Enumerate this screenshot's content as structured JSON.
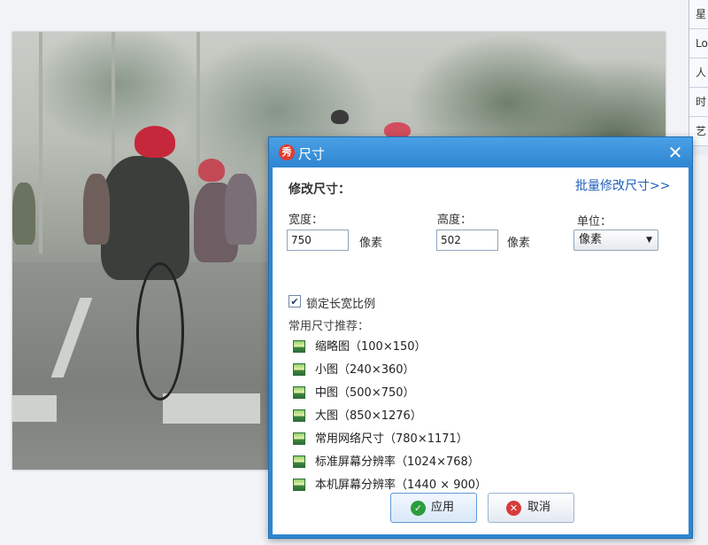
{
  "side_panel": {
    "items": [
      "星",
      "Lo",
      "人",
      "时",
      "艺"
    ]
  },
  "dialog": {
    "title": "尺寸",
    "app_icon_text": "秀",
    "close_icon": "close-icon",
    "heading": "修改尺寸：",
    "batch_link": "批量修改尺寸>>",
    "width": {
      "label": "宽度：",
      "value": "750",
      "unit": "像素"
    },
    "height": {
      "label": "高度：",
      "value": "502",
      "unit": "像素"
    },
    "unit_select": {
      "label": "单位：",
      "selected": "像素"
    },
    "lock_ratio": {
      "label": "锁定长宽比例",
      "checked": true
    },
    "presets_heading": "常用尺寸推荐：",
    "presets": [
      "缩略图（100×150）",
      "小图（240×360）",
      "中图（500×750）",
      "大图（850×1276）",
      "常用网络尺寸（780×1171）",
      "标准屏幕分辨率（1024×768）",
      "本机屏幕分辨率（1440 × 900）"
    ],
    "apply_label": "应用",
    "cancel_label": "取消"
  },
  "colors": {
    "titlebar": "#2f86d1",
    "link": "#1f5fbd",
    "apply_icon": "#2a9d3c",
    "cancel_icon": "#d83b3b"
  }
}
